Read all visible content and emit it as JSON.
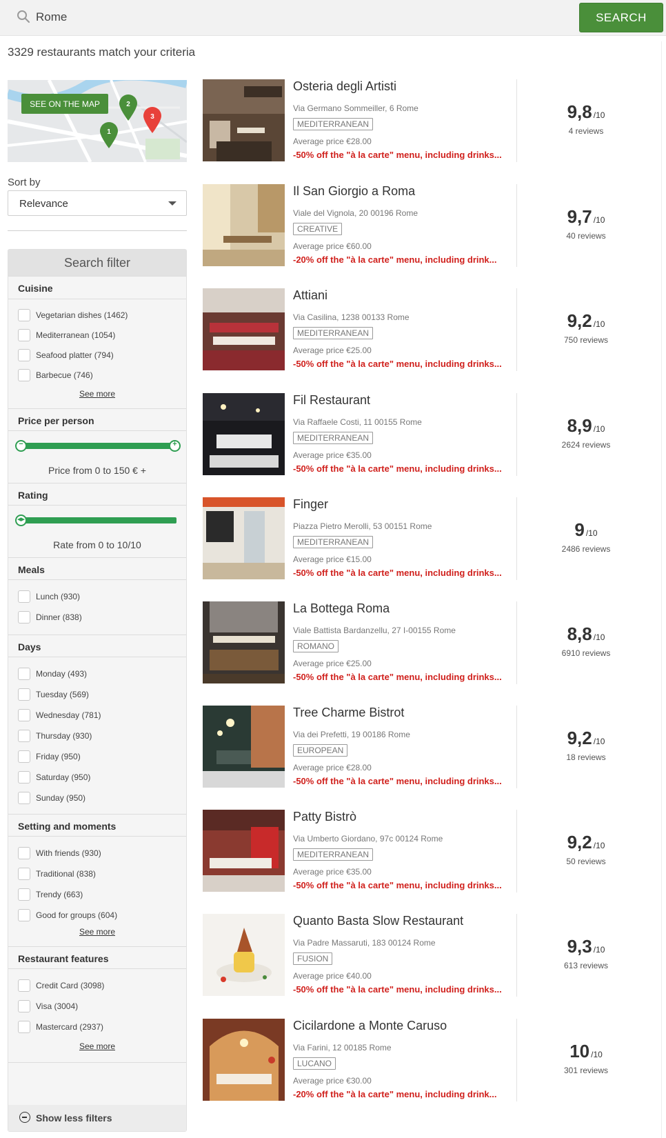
{
  "search": {
    "value": "Rome",
    "button_label": "SEARCH"
  },
  "result_count": "3329 restaurants match your criteria",
  "map": {
    "button_label": "SEE ON THE MAP",
    "pins": [
      "1",
      "2",
      "3"
    ]
  },
  "sort": {
    "label": "Sort by",
    "value": "Relevance"
  },
  "filter": {
    "title": "Search filter",
    "cuisine": {
      "title": "Cuisine",
      "options": [
        "Vegetarian dishes (1462)",
        "Mediterranean (1054)",
        "Seafood platter (794)",
        "Barbecue (746)"
      ],
      "see_more": "See more"
    },
    "price": {
      "title": "Price per person",
      "text": "Price from 0 to 150 € +",
      "min_icon": "−",
      "max_icon": "+"
    },
    "rating": {
      "title": "Rating",
      "text": "Rate from 0 to 10/10"
    },
    "meals": {
      "title": "Meals",
      "options": [
        "Lunch (930)",
        "Dinner (838)"
      ]
    },
    "days": {
      "title": "Days",
      "options": [
        "Monday (493)",
        "Tuesday (569)",
        "Wednesday (781)",
        "Thursday (930)",
        "Friday (950)",
        "Saturday (950)",
        "Sunday (950)"
      ]
    },
    "setting": {
      "title": "Setting and moments",
      "options": [
        "With friends (930)",
        "Traditional (838)",
        "Trendy (663)",
        "Good for groups (604)"
      ],
      "see_more": "See more"
    },
    "features": {
      "title": "Restaurant features",
      "options": [
        "Credit Card (3098)",
        "Visa (3004)",
        "Mastercard (2937)"
      ],
      "see_more": "See more"
    },
    "show_less": "Show less filters"
  },
  "restaurants": [
    {
      "name": "Osteria degli Artisti",
      "address": "Via Germano Sommeiller, 6 Rome",
      "tag": "MEDITERRANEAN",
      "price": "Average price €28.00",
      "offer": "-50% off the \"à la carte\" menu, including drinks...",
      "score": "9,8",
      "score_den": "/10",
      "reviews": "4 reviews"
    },
    {
      "name": "Il San Giorgio a Roma",
      "address": "Viale del Vignola, 20 00196 Rome",
      "tag": "CREATIVE",
      "price": "Average price €60.00",
      "offer": "-20% off the \"à la carte\" menu, including drink...",
      "score": "9,7",
      "score_den": "/10",
      "reviews": "40 reviews"
    },
    {
      "name": "Attiani",
      "address": "Via Casilina, 1238 00133 Rome",
      "tag": "MEDITERRANEAN",
      "price": "Average price €25.00",
      "offer": "-50% off the \"à la carte\" menu, including drinks...",
      "score": "9,2",
      "score_den": "/10",
      "reviews": "750 reviews"
    },
    {
      "name": "Fil Restaurant",
      "address": "Via Raffaele Costi, 11 00155 Rome",
      "tag": "MEDITERRANEAN",
      "price": "Average price €35.00",
      "offer": "-50% off the \"à la carte\" menu, including drinks...",
      "score": "8,9",
      "score_den": "/10",
      "reviews": "2624 reviews"
    },
    {
      "name": "Finger",
      "address": "Piazza Pietro Merolli, 53 00151 Rome",
      "tag": "MEDITERRANEAN",
      "price": "Average price €15.00",
      "offer": "-50% off the \"à la carte\" menu, including drinks...",
      "score": "9",
      "score_den": "/10",
      "reviews": "2486 reviews"
    },
    {
      "name": "La Bottega Roma",
      "address": "Viale Battista Bardanzellu, 27 I-00155 Rome",
      "tag": "ROMANO",
      "price": "Average price €25.00",
      "offer": "-50% off the \"à la carte\" menu, including drinks...",
      "score": "8,8",
      "score_den": "/10",
      "reviews": "6910 reviews"
    },
    {
      "name": "Tree Charme Bistrot",
      "address": "Via dei Prefetti, 19 00186 Rome",
      "tag": "EUROPEAN",
      "price": "Average price €28.00",
      "offer": "-50% off the \"à la carte\" menu, including drinks...",
      "score": "9,2",
      "score_den": "/10",
      "reviews": "18 reviews"
    },
    {
      "name": "Patty Bistrò",
      "address": "Via Umberto Giordano, 97c 00124 Rome",
      "tag": "MEDITERRANEAN",
      "price": "Average price €35.00",
      "offer": "-50% off the \"à la carte\" menu, including drinks...",
      "score": "9,2",
      "score_den": "/10",
      "reviews": "50 reviews"
    },
    {
      "name": "Quanto Basta Slow Restaurant",
      "address": "Via Padre Massaruti, 183 00124 Rome",
      "tag": "FUSION",
      "price": "Average price €40.00",
      "offer": "-50% off the \"à la carte\" menu, including drinks...",
      "score": "9,3",
      "score_den": "/10",
      "reviews": "613 reviews"
    },
    {
      "name": "Cicilardone a Monte Caruso",
      "address": "Via Farini, 12 00185 Rome",
      "tag": "LUCANO",
      "price": "Average price €30.00",
      "offer": "-20% off the \"à la carte\" menu, including drink...",
      "score": "10",
      "score_den": "/10",
      "reviews": "301 reviews"
    }
  ],
  "colors": {
    "brand_green": "#4a8f3a",
    "slider_green": "#2f9e52",
    "offer_red": "#d0201c",
    "pin_red": "#e8413a"
  }
}
